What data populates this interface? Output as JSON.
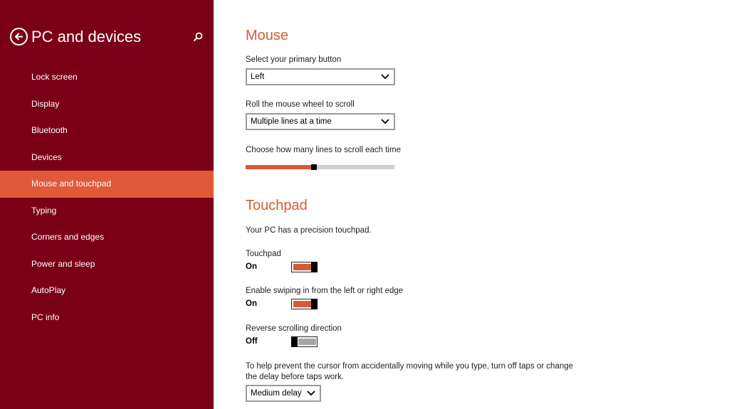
{
  "sidebar": {
    "title": "PC and devices",
    "items": [
      {
        "label": "Lock screen",
        "active": false
      },
      {
        "label": "Display",
        "active": false
      },
      {
        "label": "Bluetooth",
        "active": false
      },
      {
        "label": "Devices",
        "active": false
      },
      {
        "label": "Mouse and touchpad",
        "active": true
      },
      {
        "label": "Typing",
        "active": false
      },
      {
        "label": "Corners and edges",
        "active": false
      },
      {
        "label": "Power and sleep",
        "active": false
      },
      {
        "label": "AutoPlay",
        "active": false
      },
      {
        "label": "PC info",
        "active": false
      }
    ]
  },
  "mouse": {
    "title": "Mouse",
    "primary_button_label": "Select your primary button",
    "primary_button_value": "Left",
    "wheel_label": "Roll the mouse wheel to scroll",
    "wheel_value": "Multiple lines at a time",
    "lines_label": "Choose how many lines to scroll each time",
    "lines_fraction": 0.44
  },
  "touchpad": {
    "title": "Touchpad",
    "description": "Your PC has a precision touchpad.",
    "touchpad_label": "Touchpad",
    "touchpad_state": "On",
    "swipe_label": "Enable swiping in from the left or right edge",
    "swipe_state": "On",
    "reverse_label": "Reverse scrolling direction",
    "reverse_state": "Off",
    "delay_label": "To help prevent the cursor from accidentally moving while you type, turn off taps or change the delay before taps work.",
    "delay_value": "Medium delay"
  },
  "colors": {
    "sidebar_bg": "#7a0018",
    "accent": "#d65b34",
    "selected_item": "#e05a3a"
  },
  "icons": {
    "back": "back-arrow-circle-icon",
    "search": "search-icon",
    "dropdown": "chevron-down-icon"
  }
}
